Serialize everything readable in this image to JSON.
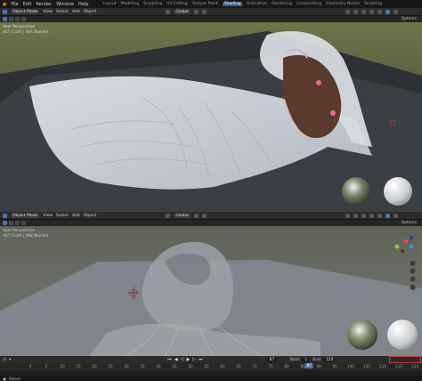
{
  "menu": {
    "items": [
      "File",
      "Edit",
      "Render",
      "Window",
      "Help"
    ],
    "workspaces": [
      "Layout",
      "Modeling",
      "Sculpting",
      "UV Editing",
      "Texture Paint",
      "Shading",
      "Animation",
      "Rendering",
      "Compositing",
      "Geometry Nodes",
      "Scripting"
    ],
    "active_workspace": "Shading"
  },
  "top_view": {
    "mode": "Object Mode",
    "menus": [
      "View",
      "Select",
      "Add",
      "Object"
    ],
    "orientation": "Global",
    "options": "Options",
    "perspective": "User Perspective",
    "object": "(87) Cloth | Wet Blanket"
  },
  "bottom_view": {
    "mode": "Object Mode",
    "menus": [
      "View",
      "Select",
      "Add",
      "Object"
    ],
    "orientation": "Global",
    "options": "Options",
    "perspective": "User Perspective",
    "object": "(87) Cloth | Wet Blanket"
  },
  "timeline": {
    "current_frame": "87",
    "start_label": "Start",
    "start_value": "1",
    "end_label": "End",
    "end_value": "120",
    "ticks": [
      "0",
      "5",
      "10",
      "15",
      "20",
      "25",
      "30",
      "35",
      "40",
      "45",
      "50",
      "55",
      "60",
      "65",
      "70",
      "75",
      "80",
      "85",
      "90",
      "95",
      "100",
      "105",
      "110",
      "115",
      "120"
    ],
    "playhead": "87"
  },
  "status": {
    "mode": "Select"
  },
  "colors": {
    "accent": "#4772b3",
    "highlight": "#c53a3a"
  }
}
